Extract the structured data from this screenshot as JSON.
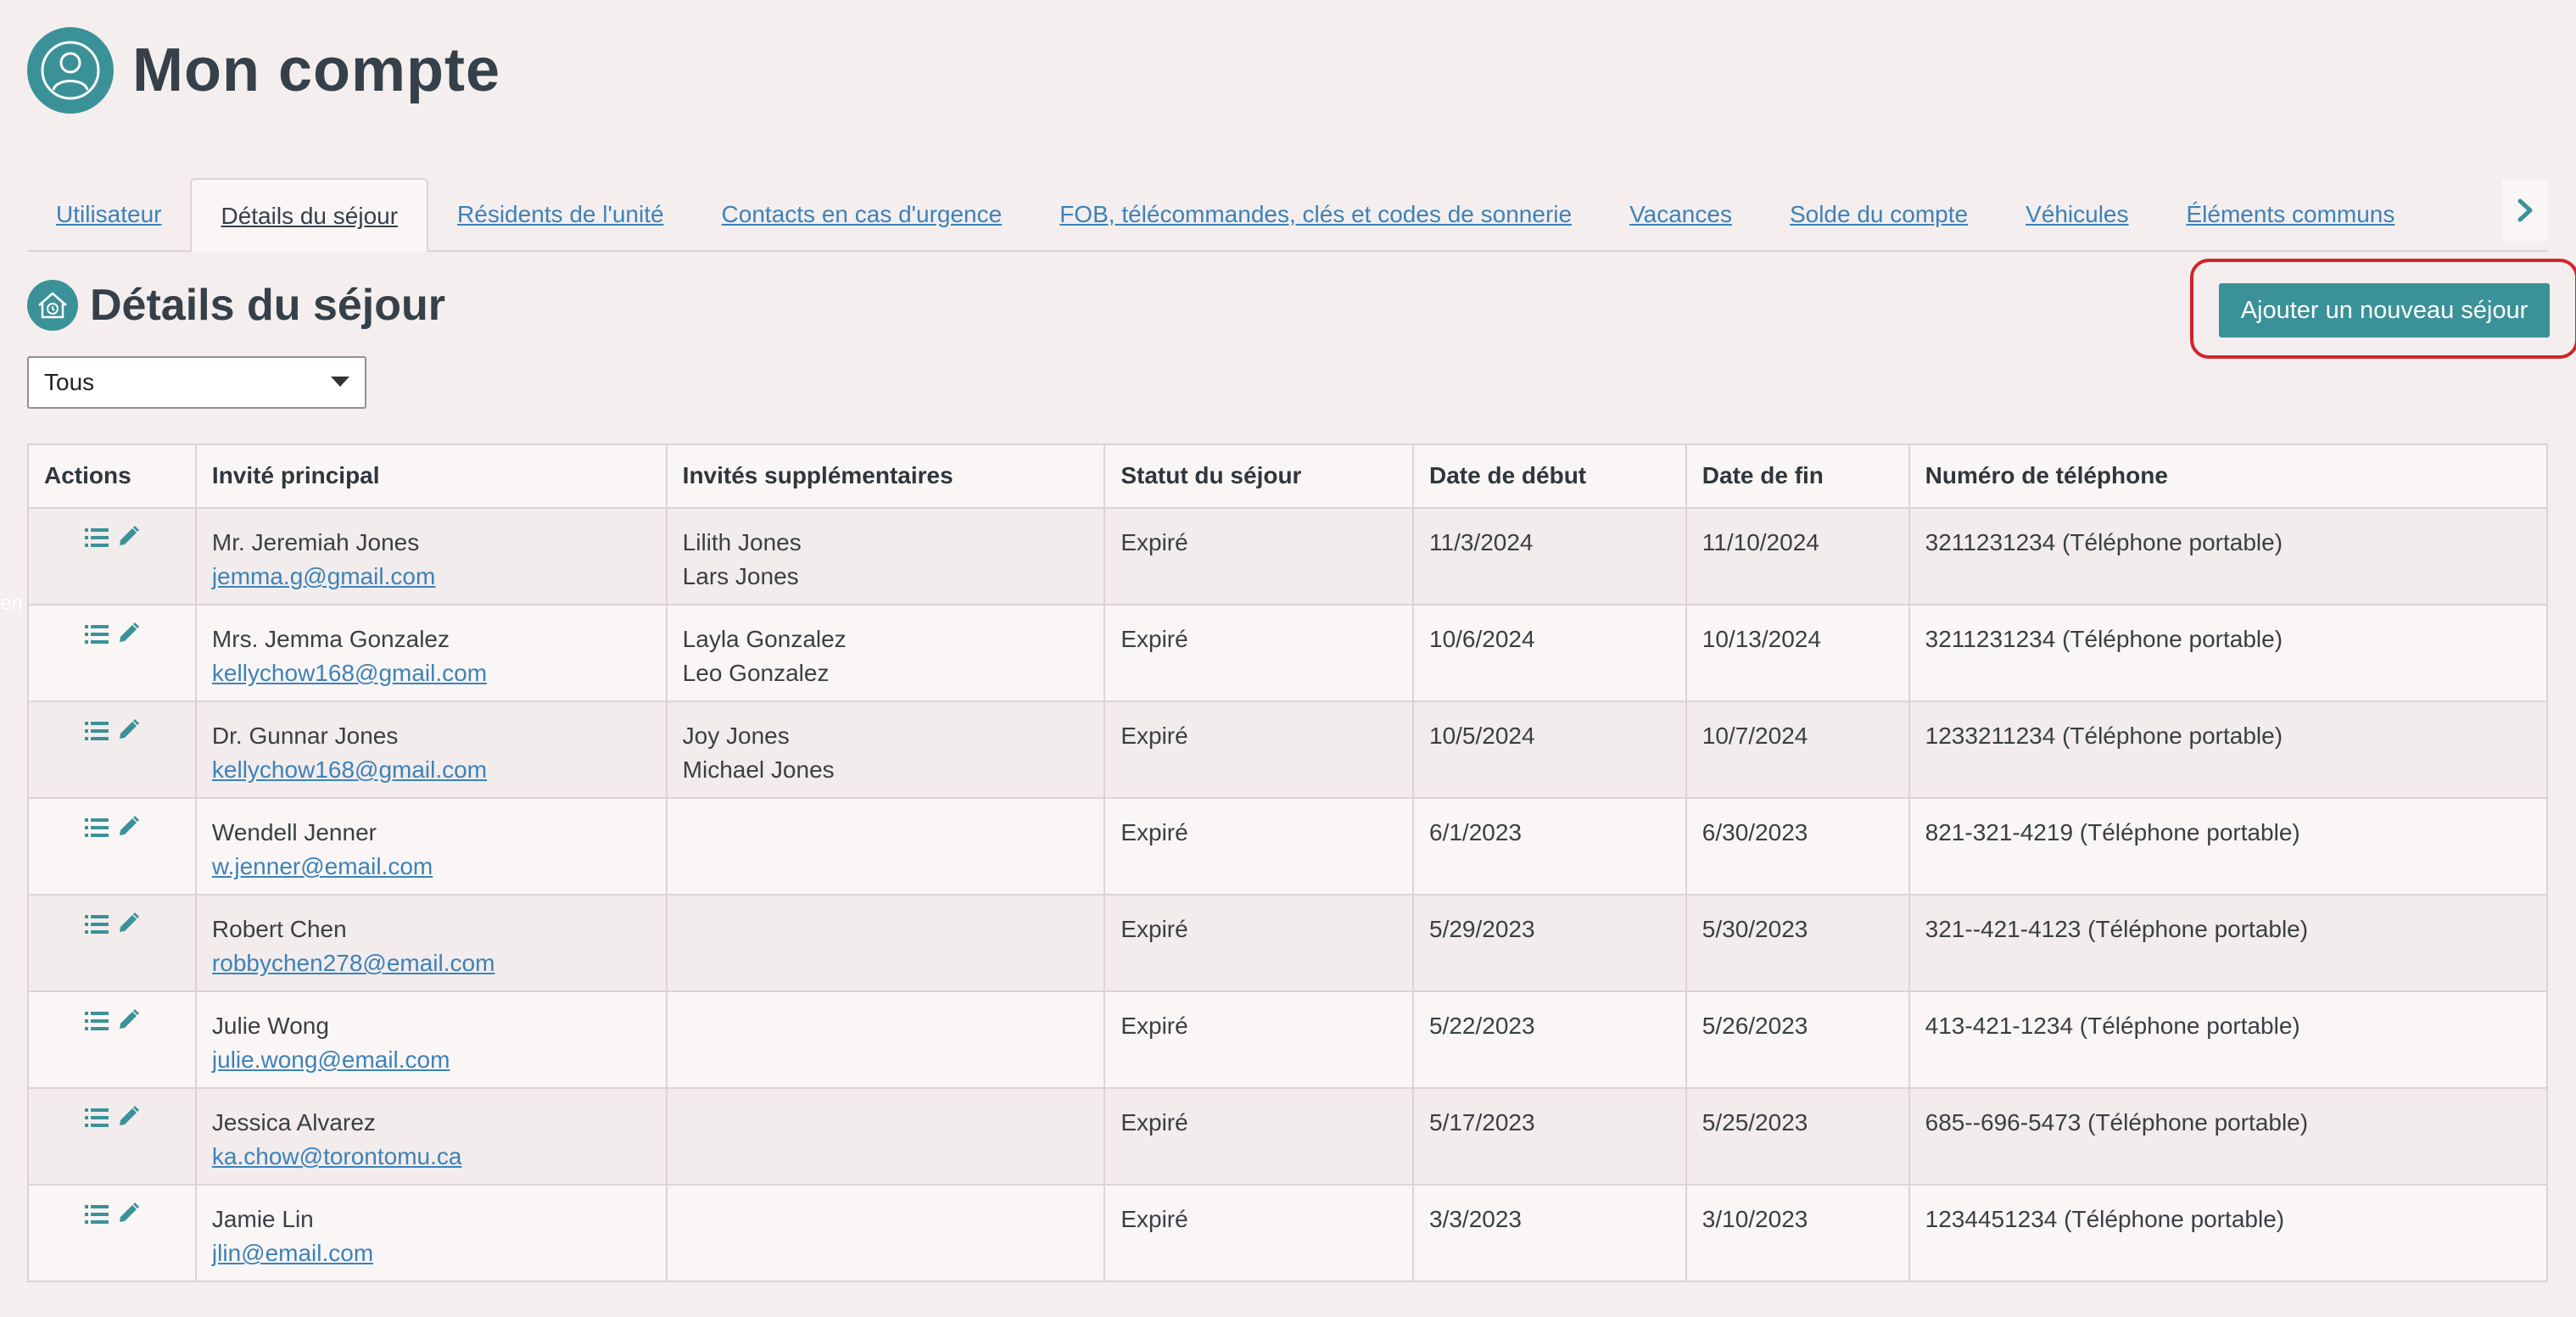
{
  "header": {
    "title": "Mon compte",
    "icon": "user-icon"
  },
  "tabs": [
    {
      "label": "Utilisateur",
      "active": false
    },
    {
      "label": "Détails du séjour",
      "active": true
    },
    {
      "label": "Résidents de l'unité",
      "active": false
    },
    {
      "label": "Contacts en cas d'urgence",
      "active": false
    },
    {
      "label": "FOB, télécommandes, clés et codes de sonnerie",
      "active": false
    },
    {
      "label": "Vacances",
      "active": false
    },
    {
      "label": "Solde du compte",
      "active": false
    },
    {
      "label": "Véhicules",
      "active": false
    },
    {
      "label": "Éléments communs",
      "active": false
    }
  ],
  "section": {
    "title": "Détails du séjour",
    "icon": "home-clock-icon"
  },
  "add_button": {
    "label": "Ajouter un nouveau séjour"
  },
  "filter": {
    "selected": "Tous"
  },
  "edge_text": "en",
  "table": {
    "columns": [
      "Actions",
      "Invité principal",
      "Invités supplémentaires",
      "Statut du séjour",
      "Date de début",
      "Date de fin",
      "Numéro de téléphone"
    ],
    "rows": [
      {
        "primary": "Mr. Jeremiah Jones",
        "email": "jemma.g@gmail.com",
        "guests": [
          "Lilith Jones",
          "Lars Jones"
        ],
        "status": "Expiré",
        "start": "11/3/2024",
        "end": "11/10/2024",
        "phone": "3211231234 (Téléphone portable)"
      },
      {
        "primary": "Mrs. Jemma Gonzalez",
        "email": "kellychow168@gmail.com",
        "guests": [
          "Layla Gonzalez",
          "Leo Gonzalez"
        ],
        "status": "Expiré",
        "start": "10/6/2024",
        "end": "10/13/2024",
        "phone": "3211231234 (Téléphone portable)"
      },
      {
        "primary": "Dr. Gunnar Jones",
        "email": "kellychow168@gmail.com",
        "guests": [
          "Joy Jones",
          "Michael Jones"
        ],
        "status": "Expiré",
        "start": "10/5/2024",
        "end": "10/7/2024",
        "phone": "1233211234 (Téléphone portable)"
      },
      {
        "primary": "Wendell Jenner",
        "email": "w.jenner@email.com",
        "guests": [],
        "status": "Expiré",
        "start": "6/1/2023",
        "end": "6/30/2023",
        "phone": "821-321-4219 (Téléphone portable)"
      },
      {
        "primary": "Robert Chen",
        "email": "robbychen278@email.com",
        "guests": [],
        "status": "Expiré",
        "start": "5/29/2023",
        "end": "5/30/2023",
        "phone": "321--421-4123 (Téléphone portable)"
      },
      {
        "primary": "Julie Wong",
        "email": "julie.wong@email.com",
        "guests": [],
        "status": "Expiré",
        "start": "5/22/2023",
        "end": "5/26/2023",
        "phone": "413-421-1234 (Téléphone portable)"
      },
      {
        "primary": "Jessica Alvarez",
        "email": "ka.chow@torontomu.ca",
        "guests": [],
        "status": "Expiré",
        "start": "5/17/2023",
        "end": "5/25/2023",
        "phone": "685--696-5473 (Téléphone portable)"
      },
      {
        "primary": "Jamie Lin",
        "email": "jlin@email.com",
        "guests": [],
        "status": "Expiré",
        "start": "3/3/2023",
        "end": "3/10/2023",
        "phone": "1234451234 (Téléphone portable)"
      }
    ]
  },
  "colors": {
    "accent": "#3a9298",
    "link": "#3d82b8",
    "highlight": "#d3232a",
    "background": "#f4eeee"
  }
}
